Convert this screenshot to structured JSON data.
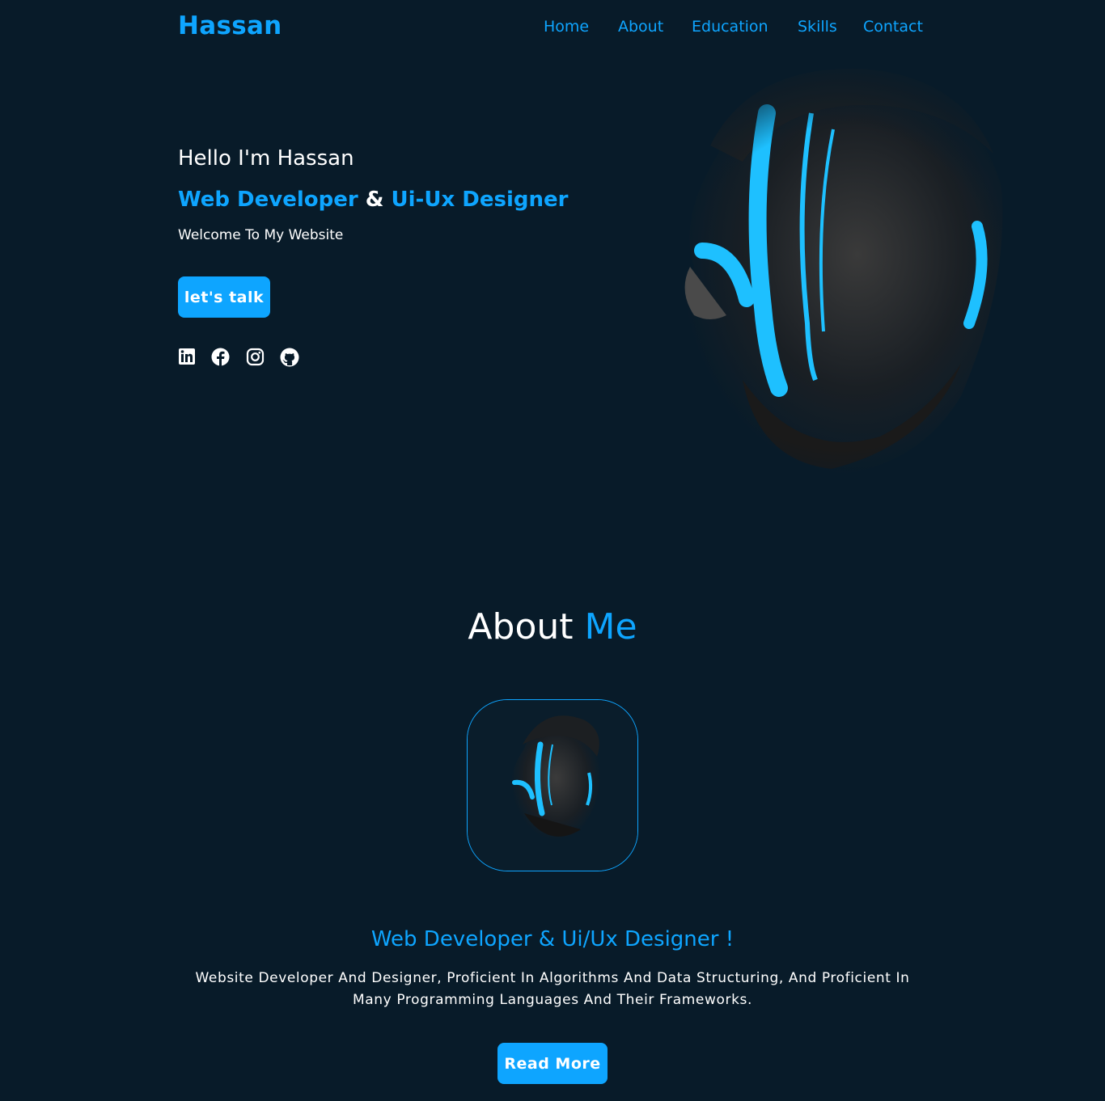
{
  "header": {
    "logo": "Hassan",
    "nav": [
      "Home",
      "About",
      "Education",
      "Skills",
      "Contact"
    ]
  },
  "hero": {
    "greeting": "Hello I'm Hassan",
    "role_1": "Web Developer",
    "role_sep": "&",
    "role_2": "Ui-Ux Designer",
    "welcome": "Welcome To My Website",
    "cta_label": "let's talk",
    "socials": [
      "linkedin-icon",
      "facebook-icon",
      "instagram-icon",
      "github-icon"
    ]
  },
  "about": {
    "title_main": "About",
    "title_accent": "Me",
    "subtitle": "Web Developer & Ui/Ux Designer !",
    "description": "Website Developer And Designer, Proficient In Algorithms And Data Structuring, And Proficient In Many Programming Languages And Their Frameworks.",
    "button_label": "Read More"
  },
  "colors": {
    "background": "#081b29",
    "accent": "#0ea5ff",
    "text": "#ffffff"
  }
}
